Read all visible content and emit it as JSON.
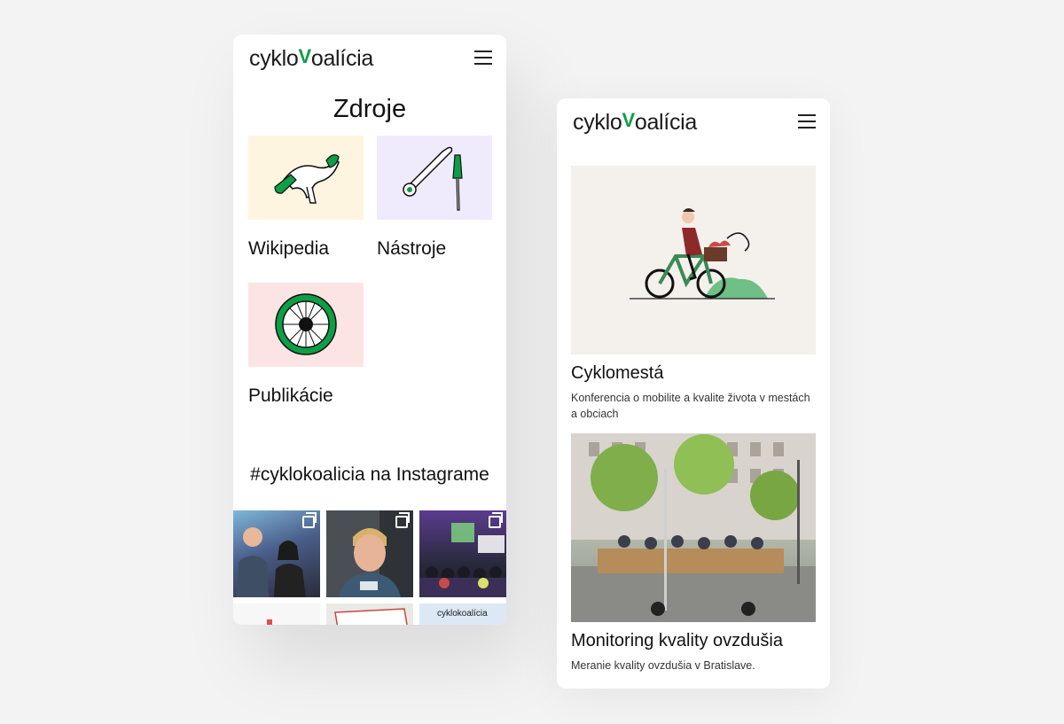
{
  "brand": {
    "logo_pre": "cyklo",
    "logo_v": "V",
    "logo_post": "oalícia",
    "accent": "#0e9e45"
  },
  "left_screen": {
    "heading": "Zdroje",
    "resources": [
      {
        "label": "Wikipedia",
        "icon": "bike-saddle-icon",
        "bg": "#fdf5e0"
      },
      {
        "label": "Nástroje",
        "icon": "tools-icon",
        "bg": "#efeafc"
      },
      {
        "label": "Publikácie",
        "icon": "wheel-icon",
        "bg": "#fde4e4"
      }
    ],
    "instagram_title": "#cyklokoalicia na Instagrame",
    "instagram_thumb_logo": "cyklokoalícia"
  },
  "right_screen": {
    "cards": [
      {
        "title": "Cyklomestá",
        "description": "Konferencia o mobilite a kvalite života v mestách a obciach"
      },
      {
        "title": "Monitoring kvality ovzdušia",
        "description": "Meranie kvality ovzdušia v Bratislave."
      }
    ]
  }
}
